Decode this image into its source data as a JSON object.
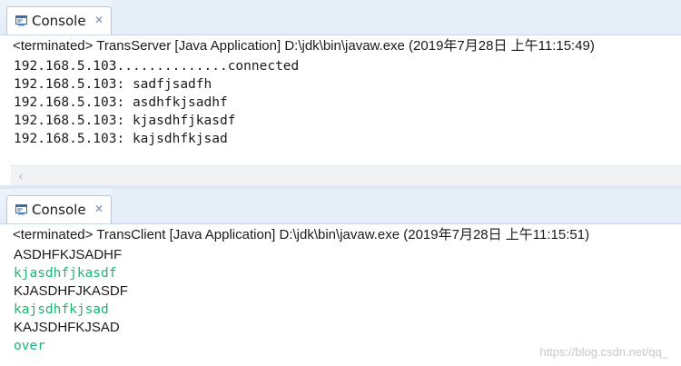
{
  "server_console": {
    "tab_label": "Console",
    "tab_icon": "console-icon",
    "close_icon": "close-icon",
    "status": "<terminated> TransServer [Java Application] D:\\jdk\\bin\\javaw.exe (2019年7月28日 上午11:15:49)",
    "lines": [
      "192.168.5.103..............connected",
      "192.168.5.103: sadfjsadfh",
      "192.168.5.103: asdhfkjsadhf",
      "192.168.5.103: kjasdhfjkasdf",
      "192.168.5.103: kajsdhfkjsad"
    ],
    "scroll_left_icon": "chevron-left-icon"
  },
  "client_console": {
    "tab_label": "Console",
    "tab_icon": "console-icon",
    "close_icon": "close-icon",
    "status": "<terminated> TransClient [Java Application] D:\\jdk\\bin\\javaw.exe (2019年7月28日 上午11:15:51)",
    "lines": [
      "ASDHFKJSADHF",
      "kjasdhfjkasdf",
      "KJASDHFJKASDF",
      "kajsdhfkjsad",
      "KAJSDHFKJSAD",
      "over"
    ]
  },
  "colors": {
    "input_echo": "#1fb471",
    "output_text": "#1a1a1a",
    "tab_strip": "#e6eef8"
  },
  "watermark": "https://blog.csdn.net/qq_"
}
